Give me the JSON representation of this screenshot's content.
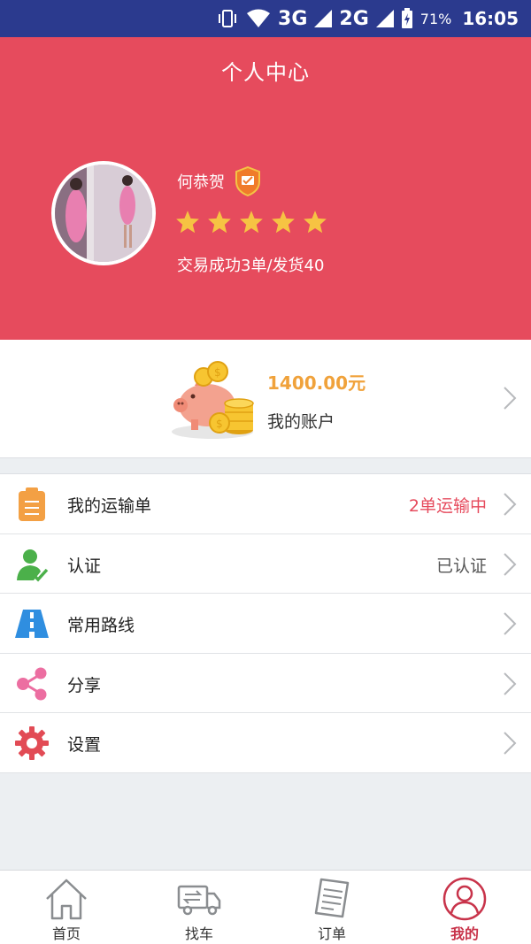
{
  "status_bar": {
    "net1": "3G",
    "net2": "2G",
    "battery": "71%",
    "time": "16:05"
  },
  "header": {
    "title": "个人中心",
    "user_name": "何恭贺",
    "rating_stars": 5,
    "trade_summary": "交易成功3单/发货40",
    "accent_color": "#e64b5d"
  },
  "account": {
    "amount": "1400.00元",
    "label": "我的账户"
  },
  "menu": {
    "items": [
      {
        "label": "我的运输单",
        "status": "2单运输中",
        "icon": "clipboard-icon"
      },
      {
        "label": "认证",
        "status": "已认证",
        "icon": "user-check-icon"
      },
      {
        "label": "常用路线",
        "status": "",
        "icon": "road-icon"
      },
      {
        "label": "分享",
        "status": "",
        "icon": "share-icon"
      },
      {
        "label": "设置",
        "status": "",
        "icon": "gear-icon"
      }
    ]
  },
  "tabbar": {
    "tabs": [
      {
        "label": "首页",
        "icon": "home-icon"
      },
      {
        "label": "找车",
        "icon": "truck-icon"
      },
      {
        "label": "订单",
        "icon": "order-icon"
      },
      {
        "label": "我的",
        "icon": "user-icon",
        "active": true
      }
    ]
  }
}
